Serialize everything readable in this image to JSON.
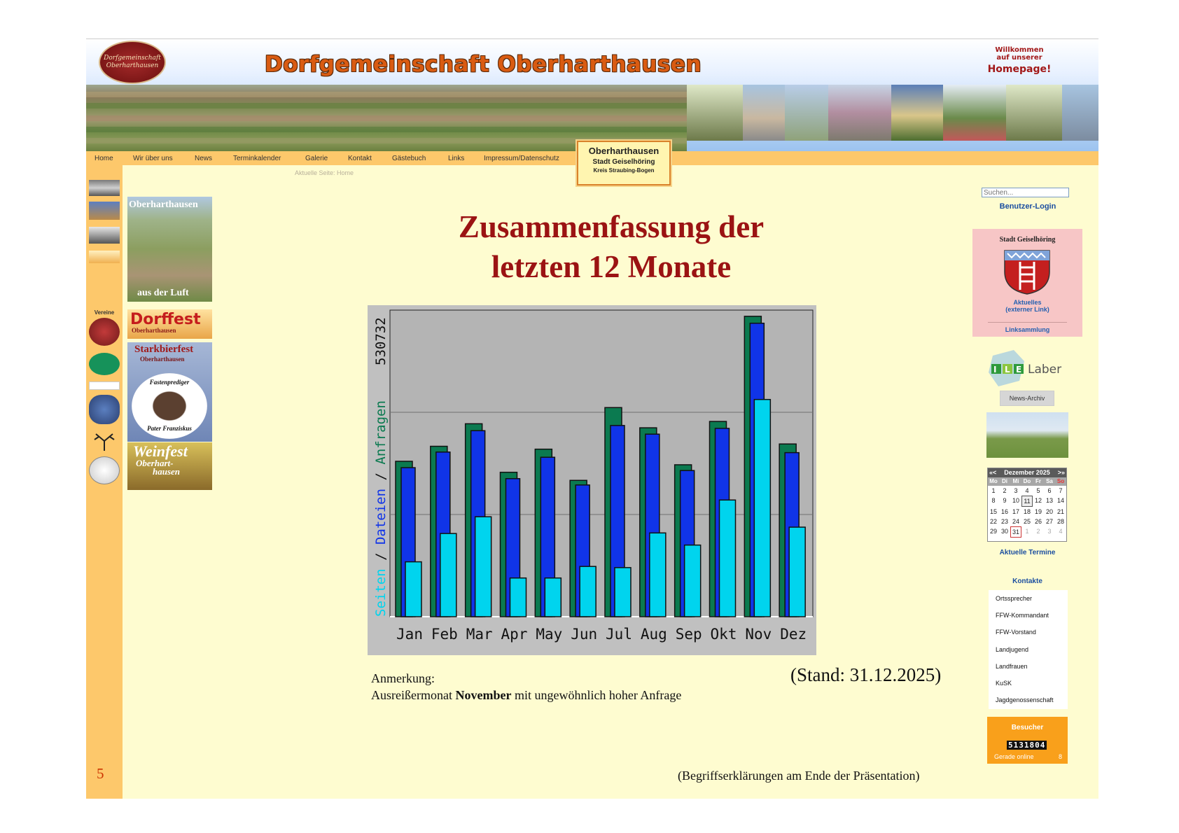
{
  "header": {
    "logo_text": "Dorfgemeinschaft Oberharthausen",
    "site_title": "Dorfgemeinschaft Oberharthausen",
    "welcome_line1": "Willkommen",
    "welcome_line2": "auf unserer",
    "welcome_line3": "Homepage!"
  },
  "nav": {
    "items": [
      "Home",
      "Wir über uns",
      "News",
      "Terminkalender",
      "Galerie",
      "Kontakt",
      "Gästebuch",
      "Links",
      "Impressum/Datenschutz"
    ],
    "breadcrumb": "Aktuelle Seite: Home"
  },
  "town_sign": {
    "name": "Oberharthausen",
    "line2": "Stadt Geiselhöring",
    "line3": "Kreis Straubing-Bogen"
  },
  "left": {
    "vereine_label": "Vereine",
    "page_number": "5"
  },
  "thumbs": {
    "luft_title": "Oberharthausen",
    "luft_sub": "aus der Luft",
    "dorffest": "Dorffest",
    "dorffest_sub": "Oberharthausen",
    "starkbier": "Starkbierfest",
    "starkbier_sub": "Oberharthausen",
    "fasten1": "Fastenprediger",
    "fasten2": "Pater Franziskus",
    "weinfest": "Weinfest",
    "weinfest_sub1": "Oberhart-",
    "weinfest_sub2": "hausen"
  },
  "main": {
    "headline_line1": "Zusammenfassung der",
    "headline_line2": "letzten 12 Monate",
    "note_label": "Anmerkung:",
    "note_text_before": "Ausreißermonat ",
    "note_text_bold": "November",
    "note_text_after": " mit ungewöhnlich hoher Anfrage",
    "stand": "(Stand: 31.12.2025)",
    "footnote": "(Begriffserklärungen am Ende der Präsentation)"
  },
  "chart_data": {
    "type": "bar",
    "categories": [
      "Jan",
      "Feb",
      "Mar",
      "Apr",
      "May",
      "Jun",
      "Jul",
      "Aug",
      "Sep",
      "Okt",
      "Nov",
      "Dez"
    ],
    "ylim": [
      0,
      530732
    ],
    "y_tick_label": "530732",
    "ylabel_parts": [
      "Seiten",
      "Dateien",
      "Anfragen"
    ],
    "ylabel_separator": " / ",
    "colors": {
      "Anfragen": "#0b7a50",
      "Dateien": "#1034e8",
      "Seiten": "#00d4ee"
    },
    "grid": true,
    "series": [
      {
        "name": "Anfragen",
        "values": [
          269000,
          295000,
          334000,
          250000,
          290000,
          236000,
          362000,
          327000,
          263000,
          338000,
          520000,
          299000
        ]
      },
      {
        "name": "Dateien",
        "values": [
          258000,
          285000,
          322000,
          239000,
          276000,
          228000,
          331000,
          316000,
          253000,
          326000,
          508000,
          284000
        ]
      },
      {
        "name": "Seiten",
        "values": [
          95000,
          144000,
          173000,
          67000,
          67000,
          87000,
          85000,
          145000,
          124000,
          202000,
          376000,
          155000
        ]
      }
    ]
  },
  "right": {
    "search_placeholder": "Suchen...",
    "login": "Benutzer-Login",
    "geiselhoering_title": "Stadt Geiselhöring",
    "aktuelles1": "Aktuelles",
    "aktuelles2": "(externer Link)",
    "linksammlung": "Linksammlung",
    "ile_text": "Laber",
    "news_archiv": "News-Archiv",
    "calendar": {
      "title": "Dezember 2025",
      "prev": "«<",
      "next": ">»",
      "weekdays": [
        "Mo",
        "Di",
        "Mi",
        "Do",
        "Fr",
        "Sa",
        "So"
      ],
      "days": [
        "1",
        "2",
        "3",
        "4",
        "5",
        "6",
        "7",
        "8",
        "9",
        "10",
        "11",
        "12",
        "13",
        "14",
        "15",
        "16",
        "17",
        "18",
        "19",
        "20",
        "21",
        "22",
        "23",
        "24",
        "25",
        "26",
        "27",
        "28",
        "29",
        "30",
        "31",
        "1",
        "2",
        "3",
        "4"
      ]
    },
    "aktuelle_termine": "Aktuelle Termine",
    "kontakte_title": "Kontakte",
    "kontakte": [
      "Ortssprecher",
      "FFW-Kommandant",
      "FFW-Vorstand",
      "Landjugend",
      "Landfrauen",
      "KuSK",
      "Jagdgenossenschaft"
    ],
    "besucher_title": "Besucher",
    "besucher_count": "5131804",
    "online_label": "Gerade online",
    "online_count": "8"
  }
}
